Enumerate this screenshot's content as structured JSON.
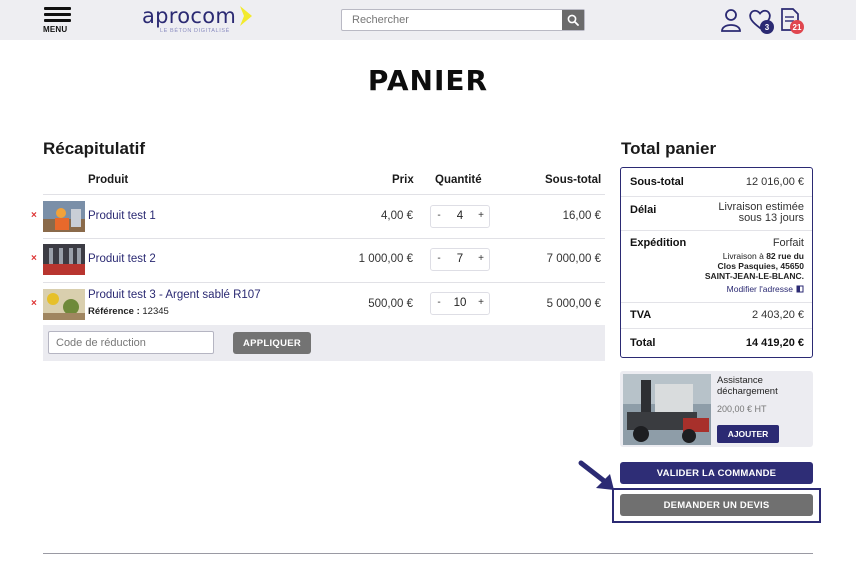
{
  "header": {
    "menu_label": "MENU",
    "logo_text": "aprocom",
    "logo_tagline": "LE BÉTON DIGITALISÉ",
    "search_placeholder": "Rechercher",
    "wishlist_count": "3",
    "quotes_count": "21",
    "colors": {
      "brand": "#2b2a73",
      "accent": "#f2ea2e",
      "badge_wishlist": "#2b2a73",
      "badge_quotes": "#e0464f"
    }
  },
  "page": {
    "title": "PANIER"
  },
  "recap": {
    "title": "Récapitulatif",
    "columns": {
      "product": "Produit",
      "price": "Prix",
      "quantity": "Quantité",
      "subtotal": "Sous-total"
    },
    "items": [
      {
        "name": "Produit test 1",
        "price": "4,00 €",
        "qty": "4",
        "subtotal": "16,00 €"
      },
      {
        "name": "Produit test 2",
        "price": "1 000,00 €",
        "qty": "7",
        "subtotal": "7 000,00 €"
      },
      {
        "name": "Produit test 3 - Argent sablé R107",
        "ref_label": "Référence :",
        "ref_value": "12345",
        "price": "500,00 €",
        "qty": "10",
        "subtotal": "5 000,00 €"
      }
    ],
    "qty_minus": "-",
    "qty_plus": "+",
    "remove_symbol": "×",
    "coupon_placeholder": "Code de réduction",
    "apply_label": "APPLIQUER"
  },
  "total": {
    "title": "Total panier",
    "subtotal_label": "Sous-total",
    "subtotal_value": "12 016,00 €",
    "delay_label": "Délai",
    "delay_value_1": "Livraison estimée",
    "delay_value_2": "sous 13 jours",
    "shipping_label": "Expédition",
    "shipping_value": "Forfait",
    "shipping_addr_1_pre": "Livraison à ",
    "shipping_addr_1_bold": "82 rue du",
    "shipping_addr_2": "Clos Pasquies, 45650",
    "shipping_addr_3": "SAINT-JEAN-LE-BLANC.",
    "modify_address": "Modifier l'adresse",
    "vat_label": "TVA",
    "vat_value": "2 403,20 €",
    "total_label": "Total",
    "total_value": "14 419,20 €"
  },
  "assist": {
    "title": "Assistance déchargement",
    "price": "200,00 € HT",
    "add_label": "AJOUTER"
  },
  "actions": {
    "validate_label": "VALIDER LA COMMANDE",
    "quote_label": "DEMANDER UN DEVIS"
  }
}
